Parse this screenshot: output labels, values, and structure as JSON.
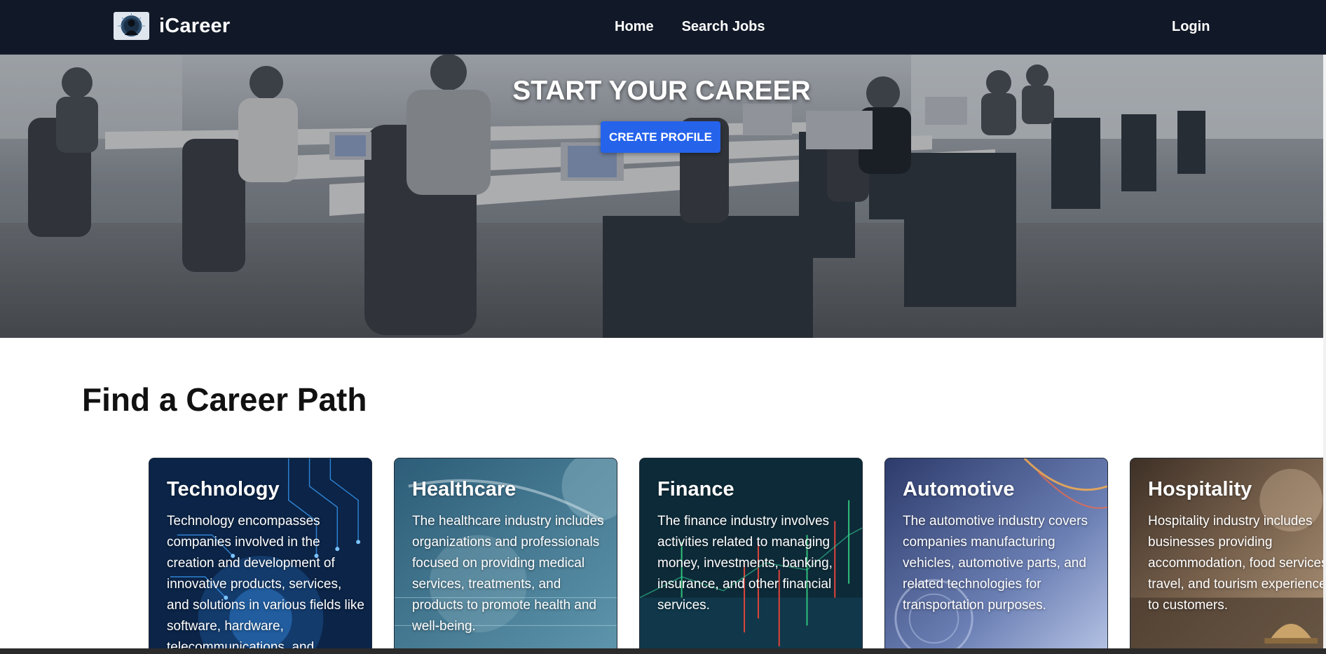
{
  "navbar": {
    "brand_name": "iCareer",
    "links": [
      "Home",
      "Search Jobs"
    ],
    "login_label": "Login"
  },
  "hero": {
    "title": "START YOUR CAREER",
    "cta_label": "CREATE PROFILE"
  },
  "section": {
    "title": "Find a Career Path"
  },
  "cards": [
    {
      "title": "Technology",
      "text": "Technology encompasses companies involved in the creation and development of innovative products, services, and solutions in various fields like software, hardware, telecommunications, and"
    },
    {
      "title": "Healthcare",
      "text": "The healthcare industry includes organizations and professionals focused on providing medical services, treatments, and products to promote health and well-being."
    },
    {
      "title": "Finance",
      "text": "The finance industry involves activities related to managing money, investments, banking, insurance, and other financial services."
    },
    {
      "title": "Automotive",
      "text": "The automotive industry covers companies manufacturing vehicles, automotive parts, and related technologies for transportation purposes."
    },
    {
      "title": "Hospitality",
      "text": "Hospitality industry includes businesses providing accommodation, food services, travel, and tourism experiences to customers."
    }
  ],
  "colors": {
    "navbar_bg": "#111827",
    "cta_bg": "#2563eb",
    "heading_text": "#111111"
  }
}
